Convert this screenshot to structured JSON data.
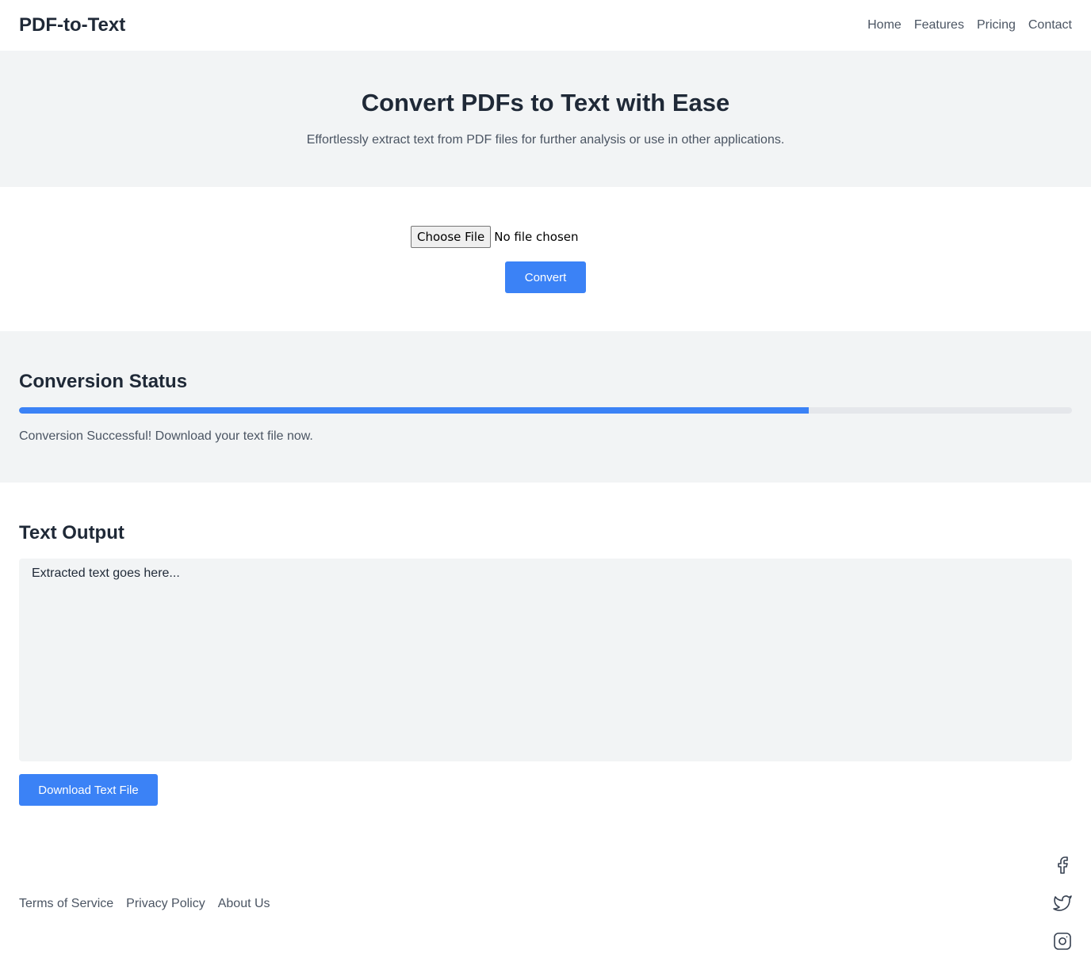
{
  "header": {
    "logo": "PDF-to-Text",
    "nav": [
      "Home",
      "Features",
      "Pricing",
      "Contact"
    ]
  },
  "hero": {
    "title": "Convert PDFs to Text with Ease",
    "subtitle": "Effortlessly extract text from PDF files for further analysis or use in other applications."
  },
  "upload": {
    "choose_file_label": "Choose File",
    "file_status": "No file chosen",
    "convert_label": "Convert"
  },
  "status": {
    "heading": "Conversion Status",
    "progress": 0.75,
    "message": "Conversion Successful! Download your text file now."
  },
  "output": {
    "heading": "Text Output",
    "placeholder": "Extracted text goes here...",
    "download_label": "Download Text File"
  },
  "footer": {
    "links": [
      "Terms of Service",
      "Privacy Policy",
      "About Us"
    ],
    "social_icons": [
      "facebook-icon",
      "twitter-icon",
      "instagram-icon"
    ]
  },
  "colors": {
    "accent": "#3b82f6",
    "section_bg": "#f2f4f5",
    "text_dark": "#1f2937",
    "text_muted": "#4b5563"
  }
}
